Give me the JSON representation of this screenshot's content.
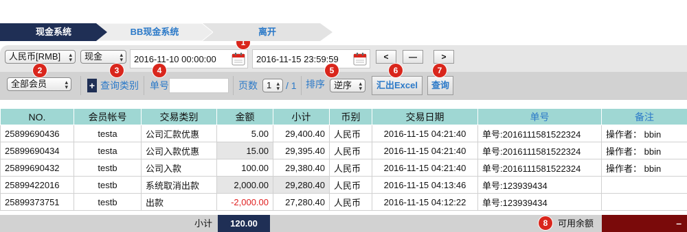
{
  "tabs": [
    {
      "label": "现金系统",
      "active": true
    },
    {
      "label": "BB现金系统",
      "active": false
    },
    {
      "label": "离开",
      "active": false
    }
  ],
  "filters": {
    "currency": "人民币[RMB]",
    "account_type": "现金",
    "start_date": "2016-11-10 00:00:00",
    "end_date": "2016-11-15 23:59:59",
    "nav_prev": "<",
    "nav_mid": "—",
    "nav_next": ">",
    "member_scope": "全部会员",
    "query_type_label": "查询类别",
    "order_no_label": "单号",
    "order_no_value": "",
    "page_label": "页数",
    "page_value": "1",
    "page_total": "/ 1",
    "sort_label": "排序",
    "sort_value": "逆序",
    "export_button": "汇出Excel",
    "query_button": "查询",
    "plus": "+"
  },
  "badges": [
    "1",
    "2",
    "3",
    "4",
    "5",
    "6",
    "7",
    "8"
  ],
  "table": {
    "headers": [
      "NO.",
      "会员帐号",
      "交易类别",
      "金额",
      "小计",
      "币别",
      "交易日期",
      "单号",
      "备注"
    ],
    "rows": [
      {
        "no": "25899690436",
        "account": "testa",
        "type": "公司汇款优惠",
        "amount": "5.00",
        "subtotal": "29,400.40",
        "currency": "人民币",
        "date": "2016-11-15 04:21:40",
        "order": "单号:2016111581522324",
        "note": "操作者： bbin"
      },
      {
        "no": "25899690434",
        "account": "testa",
        "type": "公司入款优惠",
        "amount": "15.00",
        "subtotal": "29,395.40",
        "currency": "人民币",
        "date": "2016-11-15 04:21:40",
        "order": "单号:2016111581522324",
        "note": "操作者： bbin"
      },
      {
        "no": "25899690432",
        "account": "testb",
        "type": "公司入款",
        "amount": "100.00",
        "subtotal": "29,380.40",
        "currency": "人民币",
        "date": "2016-11-15 04:21:40",
        "order": "单号:2016111581522324",
        "note": "操作者： bbin"
      },
      {
        "no": "25899422016",
        "account": "testb",
        "type": "系统取消出款",
        "amount": "2,000.00",
        "subtotal": "29,280.40",
        "currency": "人民币",
        "date": "2016-11-15 04:13:46",
        "order": "单号:123939434",
        "note": ""
      },
      {
        "no": "25899373751",
        "account": "testb",
        "type": "出款",
        "amount": "-2,000.00",
        "subtotal": "27,280.40",
        "currency": "人民币",
        "date": "2016-11-15 04:12:22",
        "order": "单号:123939434",
        "note": ""
      }
    ]
  },
  "footer": {
    "subtotal_label": "小计",
    "subtotal_value": "120.00",
    "balance_label": "可用余额",
    "balance_value": "–"
  },
  "colors": {
    "tab_active": "#1f2f55",
    "accent_blue": "#2b79c8",
    "header_teal": "#9fd7d3",
    "badge_red": "#d9261c",
    "balance_red": "#7a0a0a",
    "negative": "#e02020"
  }
}
